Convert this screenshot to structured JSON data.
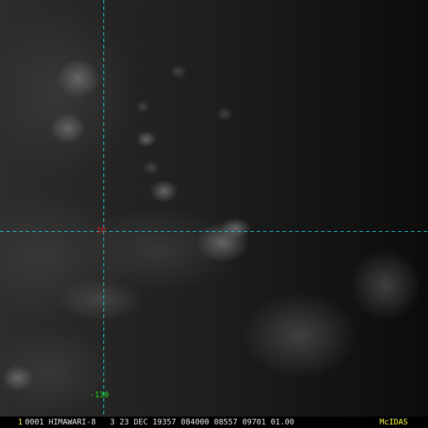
{
  "colors": {
    "grid_line": "#22d3d3",
    "latitude_label": "#cc2020",
    "longitude_label": "#22dd22",
    "status_frame_number": "#ffff44",
    "status_text": "#e8e8e8",
    "mcidas_logo": "#ffff44"
  },
  "grid": {
    "latitude_label": "10",
    "longitude_label": "-130"
  },
  "status_bar": {
    "frame_number": "1",
    "text": "0001 HIMAWARI-8   3 23 DEC 19357 084000 08557 09701 01.00",
    "mcidas": "McIDAS"
  }
}
